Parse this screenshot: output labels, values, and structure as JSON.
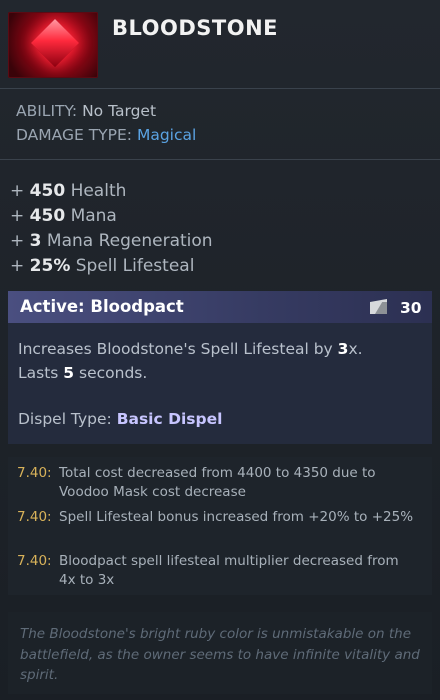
{
  "item": {
    "name": "BLOODSTONE",
    "icon": "bloodstone-gem-icon"
  },
  "meta": {
    "ability_label": "ABILITY:",
    "ability_value": "No Target",
    "damage_label": "DAMAGE TYPE:",
    "damage_value": "Magical",
    "damage_color": "#5aa3e3"
  },
  "stats": [
    {
      "prefix": "+",
      "value": "450",
      "label": "Health"
    },
    {
      "prefix": "+",
      "value": "450",
      "label": "Mana"
    },
    {
      "prefix": "+",
      "value": "3",
      "label": "Mana Regeneration"
    },
    {
      "prefix": "+",
      "value": "25%",
      "label": "Spell Lifesteal"
    }
  ],
  "active": {
    "title": "Active: Bloodpact",
    "cooldown_icon": "cooldown-icon",
    "cooldown": "30",
    "desc_part1": "Increases Bloodstone's Spell Lifesteal by ",
    "desc_mult": "3",
    "desc_part2": "x.",
    "lasts_part1": "Lasts ",
    "lasts_value": "5",
    "lasts_part2": " seconds.",
    "dispel_label": "Dispel Type: ",
    "dispel_value": "Basic Dispel"
  },
  "notes": [
    {
      "version": "7.40:",
      "text": "Total cost decreased from 4400 to 4350 due to Voodoo Mask cost decrease"
    },
    {
      "version": "7.40:",
      "text": "Spell Lifesteal bonus increased from +20% to +25%"
    },
    {
      "version": "7.40:",
      "text": "Bloodpact spell lifesteal multiplier decreased from 4x to 3x"
    }
  ],
  "lore": "The Bloodstone's bright ruby color is unmistakable on the battlefield, as the owner seems to have infinite vitality and spirit."
}
